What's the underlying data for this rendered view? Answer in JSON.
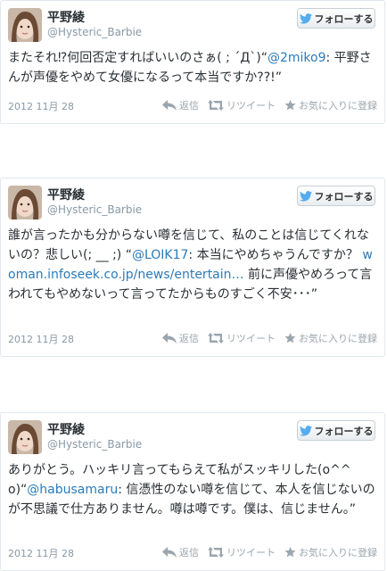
{
  "tweets": [
    {
      "name": "平野綾",
      "handle": "@Hysteric_Barbie",
      "follow_label": "フォローする",
      "text_parts": [
        "またそれ⁉何回否定すればいいのさぁ( ; ´Д`)“",
        "@2miko9",
        ": 平野さんが声優をやめて女優になるって本当ですか??!”"
      ],
      "date": "2012 11月 28",
      "reply_label": "返信",
      "retweet_label": "リツイート",
      "favorite_label": "お気に入りに登録"
    },
    {
      "name": "平野綾",
      "handle": "@Hysteric_Barbie",
      "follow_label": "フォローする",
      "text_parts": [
        "誰が言ったかも分からない噂を信じて、私のことは信じてくれないの？悲しい(; __ ;) “",
        "@LOIK17",
        ": 本当にやめちゃうんですか？ ",
        "woman.infoseek.co.jp/news/entertain…",
        " 前に声優やめろって言われてもやめないって言ってたからものすごく不安･･･”"
      ],
      "date": "2012 11月 28",
      "reply_label": "返信",
      "retweet_label": "リツイート",
      "favorite_label": "お気に入りに登録"
    },
    {
      "name": "平野綾",
      "handle": "@Hysteric_Barbie",
      "follow_label": "フォローする",
      "text_parts": [
        "ありがとう。ハッキリ言ってもらえて私がスッキリした(o^^o)“",
        "@habusamaru",
        ": 信憑性のない噂を信じて、本人を信じないのが不思議で仕方ありません。噂は噂です。僕は、信じません。”"
      ],
      "date": "2012 11月 28",
      "reply_label": "返信",
      "retweet_label": "リツイート",
      "favorite_label": "お気に入りに登録"
    }
  ],
  "colors": {
    "text": "#292f33",
    "muted": "#8899a6",
    "link": "#2b7bb9",
    "twitter_blue": "#55acee"
  },
  "icons": {
    "bird": "twitter-bird-icon",
    "reply": "reply-arrow-icon",
    "retweet": "retweet-icon",
    "favorite": "star-icon"
  }
}
